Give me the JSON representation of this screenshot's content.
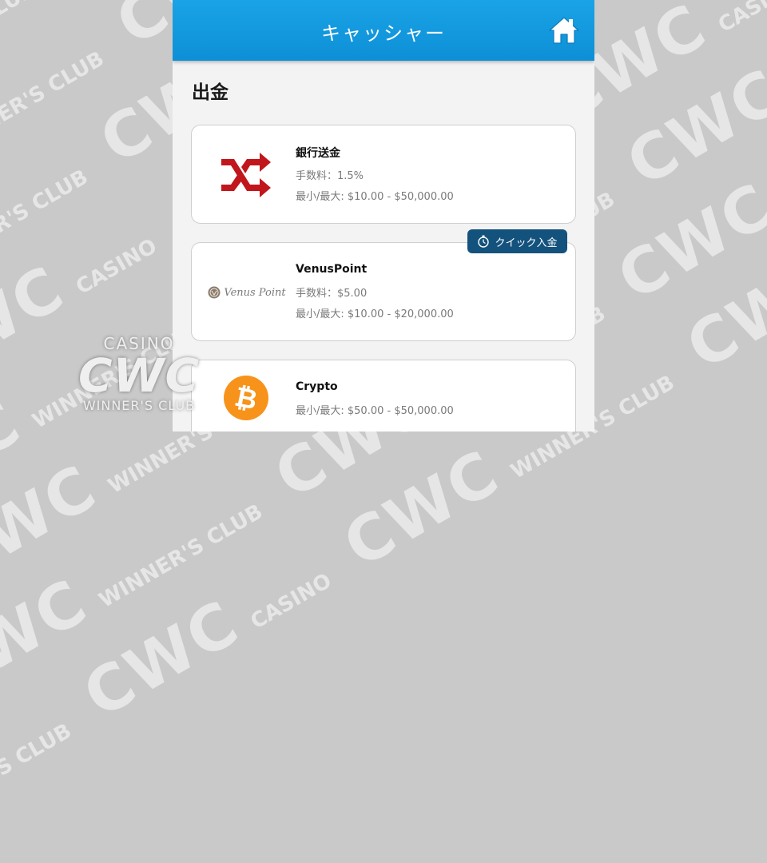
{
  "header": {
    "title": "キャッシャー"
  },
  "section": {
    "title": "出金"
  },
  "methods": [
    {
      "name": "銀行送金",
      "fee": "手数料：1.5%",
      "limits": "最小/最大: $10.00 - $50,000.00",
      "icon": "shuffle-arrows-icon"
    },
    {
      "name": "VenusPoint",
      "fee": "手数料：$5.00",
      "limits": "最小/最大: $10.00 - $20,000.00",
      "icon": "venus-point-logo",
      "logo_text": "Venus Point",
      "badge": "クイック入金"
    },
    {
      "name": "Crypto",
      "limits": "最小/最大: $50.00 - $50,000.00",
      "icon": "bitcoin-icon"
    }
  ],
  "watermark": {
    "logo_top": "CASINO",
    "logo_main": "CWC",
    "logo_bottom": "WINNER'S CLUB"
  },
  "colors": {
    "header": "#0d8fd6",
    "badge": "#13527d",
    "bitcoin": "#f7931a",
    "bank_arrows": "#c0161c"
  }
}
